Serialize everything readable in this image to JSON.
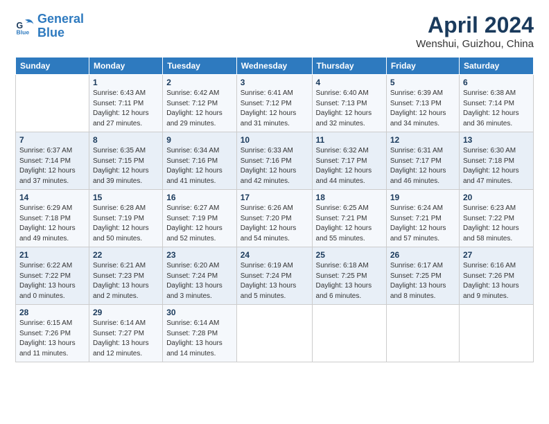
{
  "logo": {
    "line1": "General",
    "line2": "Blue"
  },
  "title": "April 2024",
  "subtitle": "Wenshui, Guizhou, China",
  "weekdays": [
    "Sunday",
    "Monday",
    "Tuesday",
    "Wednesday",
    "Thursday",
    "Friday",
    "Saturday"
  ],
  "weeks": [
    [
      {
        "day": "",
        "sunrise": "",
        "sunset": "",
        "daylight": ""
      },
      {
        "day": "1",
        "sunrise": "Sunrise: 6:43 AM",
        "sunset": "Sunset: 7:11 PM",
        "daylight": "Daylight: 12 hours and 27 minutes."
      },
      {
        "day": "2",
        "sunrise": "Sunrise: 6:42 AM",
        "sunset": "Sunset: 7:12 PM",
        "daylight": "Daylight: 12 hours and 29 minutes."
      },
      {
        "day": "3",
        "sunrise": "Sunrise: 6:41 AM",
        "sunset": "Sunset: 7:12 PM",
        "daylight": "Daylight: 12 hours and 31 minutes."
      },
      {
        "day": "4",
        "sunrise": "Sunrise: 6:40 AM",
        "sunset": "Sunset: 7:13 PM",
        "daylight": "Daylight: 12 hours and 32 minutes."
      },
      {
        "day": "5",
        "sunrise": "Sunrise: 6:39 AM",
        "sunset": "Sunset: 7:13 PM",
        "daylight": "Daylight: 12 hours and 34 minutes."
      },
      {
        "day": "6",
        "sunrise": "Sunrise: 6:38 AM",
        "sunset": "Sunset: 7:14 PM",
        "daylight": "Daylight: 12 hours and 36 minutes."
      }
    ],
    [
      {
        "day": "7",
        "sunrise": "Sunrise: 6:37 AM",
        "sunset": "Sunset: 7:14 PM",
        "daylight": "Daylight: 12 hours and 37 minutes."
      },
      {
        "day": "8",
        "sunrise": "Sunrise: 6:35 AM",
        "sunset": "Sunset: 7:15 PM",
        "daylight": "Daylight: 12 hours and 39 minutes."
      },
      {
        "day": "9",
        "sunrise": "Sunrise: 6:34 AM",
        "sunset": "Sunset: 7:16 PM",
        "daylight": "Daylight: 12 hours and 41 minutes."
      },
      {
        "day": "10",
        "sunrise": "Sunrise: 6:33 AM",
        "sunset": "Sunset: 7:16 PM",
        "daylight": "Daylight: 12 hours and 42 minutes."
      },
      {
        "day": "11",
        "sunrise": "Sunrise: 6:32 AM",
        "sunset": "Sunset: 7:17 PM",
        "daylight": "Daylight: 12 hours and 44 minutes."
      },
      {
        "day": "12",
        "sunrise": "Sunrise: 6:31 AM",
        "sunset": "Sunset: 7:17 PM",
        "daylight": "Daylight: 12 hours and 46 minutes."
      },
      {
        "day": "13",
        "sunrise": "Sunrise: 6:30 AM",
        "sunset": "Sunset: 7:18 PM",
        "daylight": "Daylight: 12 hours and 47 minutes."
      }
    ],
    [
      {
        "day": "14",
        "sunrise": "Sunrise: 6:29 AM",
        "sunset": "Sunset: 7:18 PM",
        "daylight": "Daylight: 12 hours and 49 minutes."
      },
      {
        "day": "15",
        "sunrise": "Sunrise: 6:28 AM",
        "sunset": "Sunset: 7:19 PM",
        "daylight": "Daylight: 12 hours and 50 minutes."
      },
      {
        "day": "16",
        "sunrise": "Sunrise: 6:27 AM",
        "sunset": "Sunset: 7:19 PM",
        "daylight": "Daylight: 12 hours and 52 minutes."
      },
      {
        "day": "17",
        "sunrise": "Sunrise: 6:26 AM",
        "sunset": "Sunset: 7:20 PM",
        "daylight": "Daylight: 12 hours and 54 minutes."
      },
      {
        "day": "18",
        "sunrise": "Sunrise: 6:25 AM",
        "sunset": "Sunset: 7:21 PM",
        "daylight": "Daylight: 12 hours and 55 minutes."
      },
      {
        "day": "19",
        "sunrise": "Sunrise: 6:24 AM",
        "sunset": "Sunset: 7:21 PM",
        "daylight": "Daylight: 12 hours and 57 minutes."
      },
      {
        "day": "20",
        "sunrise": "Sunrise: 6:23 AM",
        "sunset": "Sunset: 7:22 PM",
        "daylight": "Daylight: 12 hours and 58 minutes."
      }
    ],
    [
      {
        "day": "21",
        "sunrise": "Sunrise: 6:22 AM",
        "sunset": "Sunset: 7:22 PM",
        "daylight": "Daylight: 13 hours and 0 minutes."
      },
      {
        "day": "22",
        "sunrise": "Sunrise: 6:21 AM",
        "sunset": "Sunset: 7:23 PM",
        "daylight": "Daylight: 13 hours and 2 minutes."
      },
      {
        "day": "23",
        "sunrise": "Sunrise: 6:20 AM",
        "sunset": "Sunset: 7:24 PM",
        "daylight": "Daylight: 13 hours and 3 minutes."
      },
      {
        "day": "24",
        "sunrise": "Sunrise: 6:19 AM",
        "sunset": "Sunset: 7:24 PM",
        "daylight": "Daylight: 13 hours and 5 minutes."
      },
      {
        "day": "25",
        "sunrise": "Sunrise: 6:18 AM",
        "sunset": "Sunset: 7:25 PM",
        "daylight": "Daylight: 13 hours and 6 minutes."
      },
      {
        "day": "26",
        "sunrise": "Sunrise: 6:17 AM",
        "sunset": "Sunset: 7:25 PM",
        "daylight": "Daylight: 13 hours and 8 minutes."
      },
      {
        "day": "27",
        "sunrise": "Sunrise: 6:16 AM",
        "sunset": "Sunset: 7:26 PM",
        "daylight": "Daylight: 13 hours and 9 minutes."
      }
    ],
    [
      {
        "day": "28",
        "sunrise": "Sunrise: 6:15 AM",
        "sunset": "Sunset: 7:26 PM",
        "daylight": "Daylight: 13 hours and 11 minutes."
      },
      {
        "day": "29",
        "sunrise": "Sunrise: 6:14 AM",
        "sunset": "Sunset: 7:27 PM",
        "daylight": "Daylight: 13 hours and 12 minutes."
      },
      {
        "day": "30",
        "sunrise": "Sunrise: 6:14 AM",
        "sunset": "Sunset: 7:28 PM",
        "daylight": "Daylight: 13 hours and 14 minutes."
      },
      {
        "day": "",
        "sunrise": "",
        "sunset": "",
        "daylight": ""
      },
      {
        "day": "",
        "sunrise": "",
        "sunset": "",
        "daylight": ""
      },
      {
        "day": "",
        "sunrise": "",
        "sunset": "",
        "daylight": ""
      },
      {
        "day": "",
        "sunrise": "",
        "sunset": "",
        "daylight": ""
      }
    ]
  ]
}
